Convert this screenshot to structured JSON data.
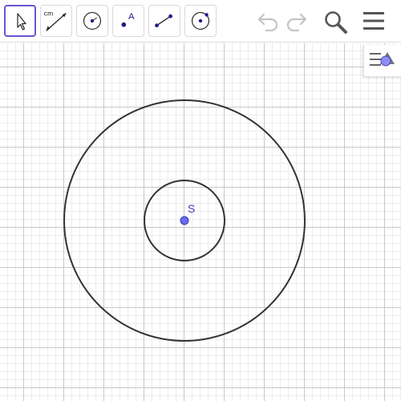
{
  "toolbar": {
    "tools": [
      {
        "name": "move",
        "icon": "cursor-arrow-icon",
        "selected": true
      },
      {
        "name": "distance",
        "icon": "distance-measure-icon",
        "label": "cm"
      },
      {
        "name": "circle-with-center",
        "icon": "circle-center-icon"
      },
      {
        "name": "point",
        "icon": "point-tool-icon",
        "label": "A"
      },
      {
        "name": "segment",
        "icon": "segment-tool-icon"
      },
      {
        "name": "circle-through-point",
        "icon": "circle-point-icon"
      }
    ],
    "actions": [
      "undo-icon",
      "redo-icon",
      "search-icon",
      "menu-icon"
    ]
  },
  "canvas": {
    "point": {
      "label": "S",
      "color": "#6a6af0"
    },
    "circles": [
      {
        "name": "small-circle",
        "radius_units": 1
      },
      {
        "name": "large-circle",
        "radius_units": 3
      }
    ],
    "grid": true
  },
  "colors": {
    "accent": "#6557d2",
    "point": "#6a6af0",
    "point_label": "#3d3dbd",
    "circle": "#333333",
    "grid_major": "#c8c8c8",
    "grid_minor": "#ececec"
  }
}
